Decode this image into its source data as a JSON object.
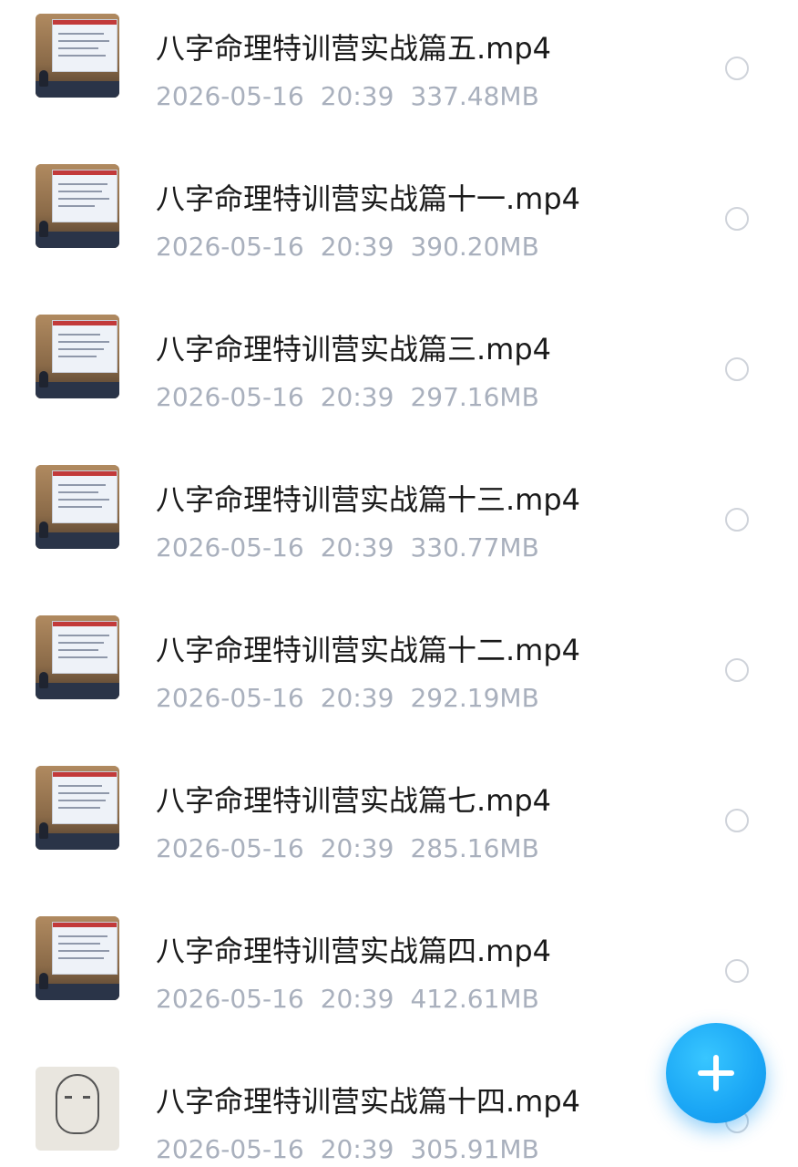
{
  "files": [
    {
      "name": "八字命理特训营实战篇五.mp4",
      "date": "2026-05-16",
      "time": "20:39",
      "size": "337.48MB",
      "thumbnail": "classroom-video-thumbnail"
    },
    {
      "name": "八字命理特训营实战篇十一.mp4",
      "date": "2026-05-16",
      "time": "20:39",
      "size": "390.20MB",
      "thumbnail": "classroom-video-thumbnail"
    },
    {
      "name": "八字命理特训营实战篇三.mp4",
      "date": "2026-05-16",
      "time": "20:39",
      "size": "297.16MB",
      "thumbnail": "classroom-video-thumbnail"
    },
    {
      "name": "八字命理特训营实战篇十三.mp4",
      "date": "2026-05-16",
      "time": "20:39",
      "size": "330.77MB",
      "thumbnail": "classroom-video-thumbnail"
    },
    {
      "name": "八字命理特训营实战篇十二.mp4",
      "date": "2026-05-16",
      "time": "20:39",
      "size": "292.19MB",
      "thumbnail": "classroom-video-thumbnail"
    },
    {
      "name": "八字命理特训营实战篇七.mp4",
      "date": "2026-05-16",
      "time": "20:39",
      "size": "285.16MB",
      "thumbnail": "classroom-video-thumbnail"
    },
    {
      "name": "八字命理特训营实战篇四.mp4",
      "date": "2026-05-16",
      "time": "20:39",
      "size": "412.61MB",
      "thumbnail": "classroom-video-thumbnail"
    },
    {
      "name": "八字命理特训营实战篇十四.mp4",
      "date": "2026-05-16",
      "time": "20:39",
      "size": "305.91MB",
      "thumbnail": "sketch-video-thumbnail"
    }
  ],
  "fab": {
    "icon": "plus-icon",
    "color": "#1aa6f5"
  },
  "colors": {
    "meta_text": "#a9b0bd",
    "name_text": "#1a1a1a",
    "radio_border": "#cfd3da"
  }
}
